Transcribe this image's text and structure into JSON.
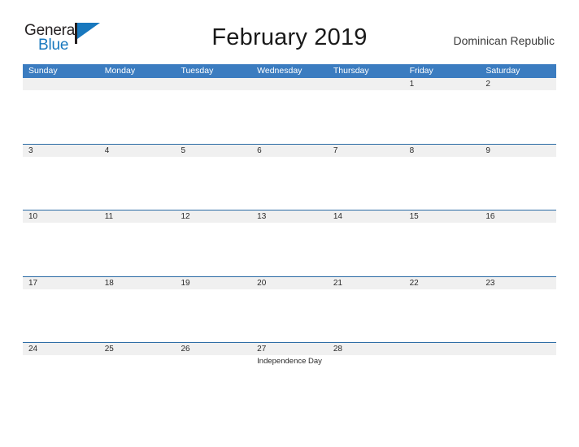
{
  "brand": {
    "name_part1": "General",
    "name_part2": "Blue",
    "flag_icon": "flag-triangle-icon"
  },
  "header": {
    "title": "February 2019",
    "country": "Dominican Republic"
  },
  "colors": {
    "header_blue": "#3b7cc0",
    "rule_blue": "#2b6ba4",
    "band_gray": "#f0f0f0",
    "brand_blue": "#1878be",
    "brand_dark": "#231f20"
  },
  "calendar": {
    "weekdays": [
      "Sunday",
      "Monday",
      "Tuesday",
      "Wednesday",
      "Thursday",
      "Friday",
      "Saturday"
    ],
    "weeks": [
      [
        {
          "day": ""
        },
        {
          "day": ""
        },
        {
          "day": ""
        },
        {
          "day": ""
        },
        {
          "day": ""
        },
        {
          "day": "1"
        },
        {
          "day": "2"
        }
      ],
      [
        {
          "day": "3"
        },
        {
          "day": "4"
        },
        {
          "day": "5"
        },
        {
          "day": "6"
        },
        {
          "day": "7"
        },
        {
          "day": "8"
        },
        {
          "day": "9"
        }
      ],
      [
        {
          "day": "10"
        },
        {
          "day": "11"
        },
        {
          "day": "12"
        },
        {
          "day": "13"
        },
        {
          "day": "14"
        },
        {
          "day": "15"
        },
        {
          "day": "16"
        }
      ],
      [
        {
          "day": "17"
        },
        {
          "day": "18"
        },
        {
          "day": "19"
        },
        {
          "day": "20"
        },
        {
          "day": "21"
        },
        {
          "day": "22"
        },
        {
          "day": "23"
        }
      ],
      [
        {
          "day": "24"
        },
        {
          "day": "25"
        },
        {
          "day": "26"
        },
        {
          "day": "27",
          "event": "Independence Day"
        },
        {
          "day": "28"
        },
        {
          "day": ""
        },
        {
          "day": ""
        }
      ]
    ]
  }
}
